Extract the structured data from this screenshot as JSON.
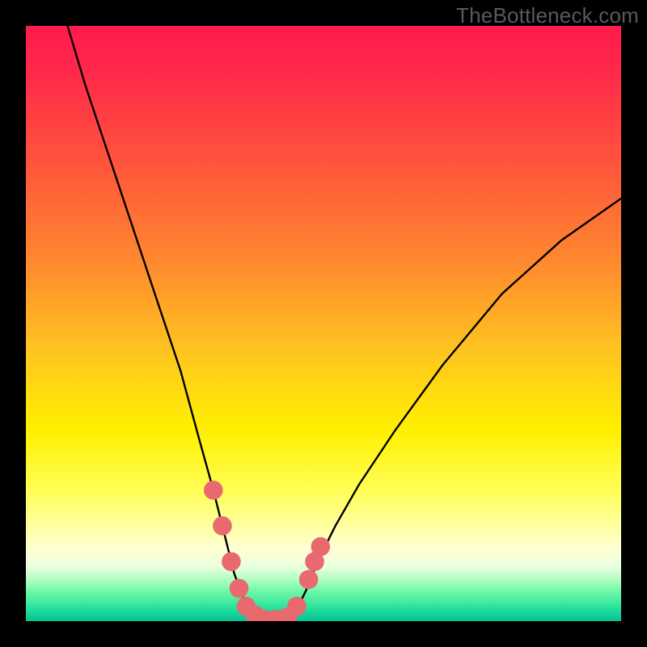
{
  "watermark": {
    "text": "TheBottleneck.com"
  },
  "colors": {
    "page_bg": "#000000",
    "curve_stroke": "#000000",
    "marker_fill": "#e96a6e",
    "gradient_stops": [
      "#ff1a4d",
      "#ff5a3a",
      "#ffc61f",
      "#fff000",
      "#ffffa0",
      "#3ce9a0",
      "#09c090"
    ]
  },
  "chart_data": {
    "type": "line",
    "title": "",
    "xlabel": "",
    "ylabel": "",
    "xlim": [
      0,
      100
    ],
    "ylim": [
      0,
      100
    ],
    "grid": false,
    "legend": false,
    "note": "axes unlabeled; values are relative percentages estimated from pixel positions",
    "series": [
      {
        "name": "bottleneck-curve",
        "x": [
          7,
          10,
          14,
          18,
          22,
          26,
          29,
          31.5,
          33.5,
          35,
          36.5,
          38,
          39,
          40,
          42,
          44,
          45.5,
          47,
          49,
          52,
          56,
          62,
          70,
          80,
          90,
          100
        ],
        "y": [
          100,
          90,
          78,
          66,
          54,
          42,
          31,
          22,
          14,
          8,
          4,
          1.5,
          0.5,
          0.3,
          0.3,
          0.7,
          2,
          5,
          10,
          16,
          23,
          32,
          43,
          55,
          64,
          71
        ]
      }
    ],
    "markers": [
      {
        "x": 31.5,
        "y": 22
      },
      {
        "x": 33.0,
        "y": 16
      },
      {
        "x": 34.5,
        "y": 10
      },
      {
        "x": 35.8,
        "y": 5.5
      },
      {
        "x": 37.0,
        "y": 2.5
      },
      {
        "x": 38.5,
        "y": 1
      },
      {
        "x": 40.0,
        "y": 0.3
      },
      {
        "x": 42.0,
        "y": 0.3
      },
      {
        "x": 44.0,
        "y": 0.7
      },
      {
        "x": 45.5,
        "y": 2.5
      },
      {
        "x": 47.5,
        "y": 7
      },
      {
        "x": 48.5,
        "y": 10
      },
      {
        "x": 49.5,
        "y": 12.5
      }
    ],
    "marker_radius_pct": 1.6
  }
}
